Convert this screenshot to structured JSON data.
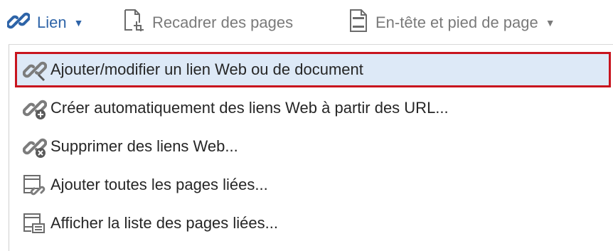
{
  "toolbar": {
    "link_label": "Lien",
    "crop_label": "Recadrer des pages",
    "header_footer_label": "En-tête et pied de page",
    "link_color": "#2e64a8",
    "disabled_color": "#7a7a7a"
  },
  "menu": {
    "items": [
      {
        "label": "Ajouter/modifier un lien Web ou de document",
        "icon": "link-edit-icon",
        "selected": true
      },
      {
        "label": "Créer automatiquement des liens Web à partir des URL...",
        "icon": "link-add-icon"
      },
      {
        "label": "Supprimer des liens Web...",
        "icon": "link-remove-icon"
      },
      {
        "label": "Ajouter toutes les pages liées...",
        "icon": "add-linked-pages-icon"
      },
      {
        "label": "Afficher la liste des pages liées...",
        "icon": "list-linked-pages-icon"
      }
    ],
    "highlight_color": "#dde9f7",
    "selection_border_color": "#c8141e"
  }
}
